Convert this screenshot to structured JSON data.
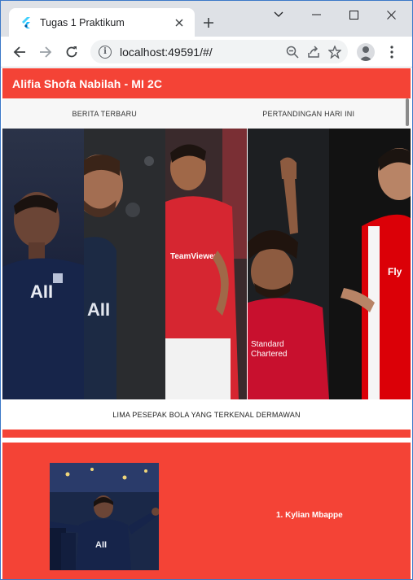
{
  "browser": {
    "tab_title": "Tugas 1 Praktikum",
    "url": "localhost:49591/#/",
    "icons": [
      "flutter-favicon",
      "close-icon",
      "plus-icon",
      "chevron-down-icon",
      "minimize-icon",
      "maximize-icon",
      "close-window-icon",
      "back-icon",
      "forward-icon",
      "reload-icon",
      "info-icon",
      "zoom-icon",
      "share-icon",
      "star-icon",
      "profile-icon",
      "kebab-menu-icon"
    ]
  },
  "app": {
    "title": "Alifia Shofa Nabilah - MI 2C",
    "accent_color": "#f44336",
    "tabs": [
      {
        "label": "BERITA TERBARU"
      },
      {
        "label": "PERTANDINGAN HARI INI"
      }
    ],
    "hero_caption": "LIMA PESEPAK BOLA YANG TERKENAL DERMAWAN",
    "players": [
      {
        "name": "1. Kylian Mbappe"
      }
    ]
  }
}
